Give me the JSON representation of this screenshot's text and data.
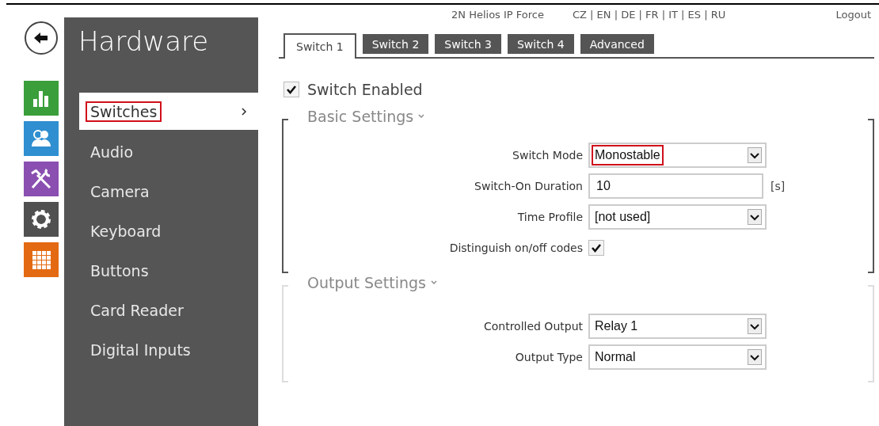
{
  "header": {
    "device": "2N Helios IP Force",
    "languages": "CZ | EN | DE | FR | IT | ES | RU",
    "logout": "Logout"
  },
  "nav_icons": [
    {
      "kind": "back"
    },
    {
      "kind": "status"
    },
    {
      "kind": "directory"
    },
    {
      "kind": "services"
    },
    {
      "kind": "system"
    },
    {
      "kind": "hardware"
    }
  ],
  "sidebar": {
    "title": "Hardware",
    "items": [
      {
        "label": "Switches",
        "selected": true,
        "highlighted": true
      },
      {
        "label": "Audio",
        "selected": false,
        "highlighted": false
      },
      {
        "label": "Camera",
        "selected": false,
        "highlighted": false
      },
      {
        "label": "Keyboard",
        "selected": false,
        "highlighted": false
      },
      {
        "label": "Buttons",
        "selected": false,
        "highlighted": false
      },
      {
        "label": "Card Reader",
        "selected": false,
        "highlighted": false
      },
      {
        "label": "Digital Inputs",
        "selected": false,
        "highlighted": false
      }
    ]
  },
  "tabs": [
    {
      "label": "Switch 1",
      "selected": true
    },
    {
      "label": "Switch 2",
      "selected": false
    },
    {
      "label": "Switch 3",
      "selected": false
    },
    {
      "label": "Switch 4",
      "selected": false
    },
    {
      "label": "Advanced",
      "selected": false
    }
  ],
  "switch_enabled": {
    "label": "Switch Enabled",
    "checked": true
  },
  "sections": [
    {
      "title": "Basic Settings",
      "focused": true,
      "fields": [
        {
          "kind": "select",
          "label": "Switch Mode",
          "value": "Monostable",
          "highlighted": true
        },
        {
          "kind": "text",
          "label": "Switch-On Duration",
          "value": "10",
          "unit": "[s]"
        },
        {
          "kind": "select",
          "label": "Time Profile",
          "value": "[not used]",
          "highlighted": false
        },
        {
          "kind": "checkbox",
          "label": "Distinguish on/off codes",
          "checked": true
        }
      ]
    },
    {
      "title": "Output Settings",
      "focused": false,
      "fields": [
        {
          "kind": "select",
          "label": "Controlled Output",
          "value": "Relay 1",
          "highlighted": false
        },
        {
          "kind": "select",
          "label": "Output Type",
          "value": "Normal",
          "highlighted": false
        }
      ]
    }
  ]
}
